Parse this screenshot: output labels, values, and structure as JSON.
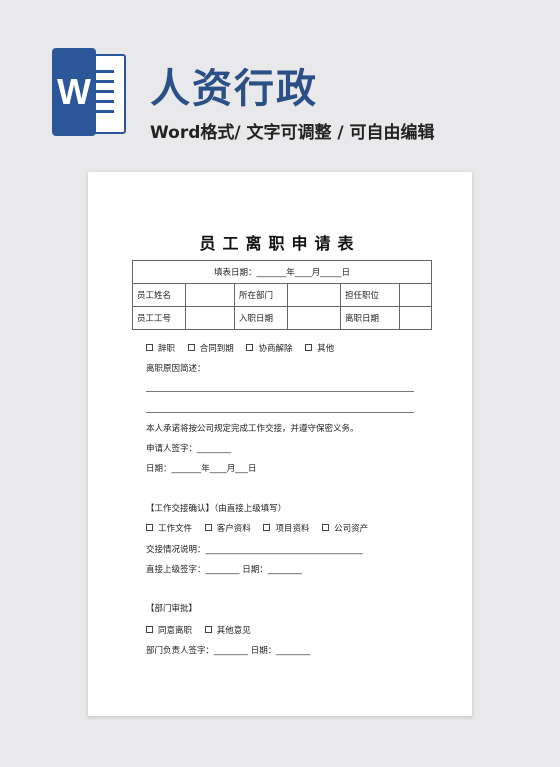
{
  "header": {
    "logo_letter": "W",
    "title": "人资行政",
    "subtitle": "Word格式/ 文字可调整 / 可自由编辑"
  },
  "doc": {
    "title": "员工离职申请表",
    "fill_date": "填表日期：_______年____月_____日",
    "row1": [
      "员工姓名",
      "",
      "所在部门",
      "",
      "担任职位",
      ""
    ],
    "row2": [
      "员工工号",
      "",
      "入职日期",
      "",
      "离职日期",
      ""
    ],
    "reasons": [
      "辞职",
      "合同到期",
      "协商解除",
      "其他"
    ],
    "reason_desc": "离职原因简述：",
    "promise": "本人承诺将按公司规定完成工作交接，并遵守保密义务。",
    "applicant_sign": "申请人签字：________",
    "date_line": "日期：_______年____月___日",
    "handover_heading": "【工作交接确认】（由直接上级填写）",
    "handover_items": [
      "工作文件",
      "客户资料",
      "项目资料",
      "公司资产"
    ],
    "handover_desc": "交接情况说明：_____________________________________",
    "supervisor_sign": "直接上级签字：________  日期：________",
    "dept_heading": "【部门审批】",
    "dept_options": [
      "同意离职",
      "其他意见"
    ],
    "dept_sign": "部门负责人签字：________  日期：________"
  }
}
